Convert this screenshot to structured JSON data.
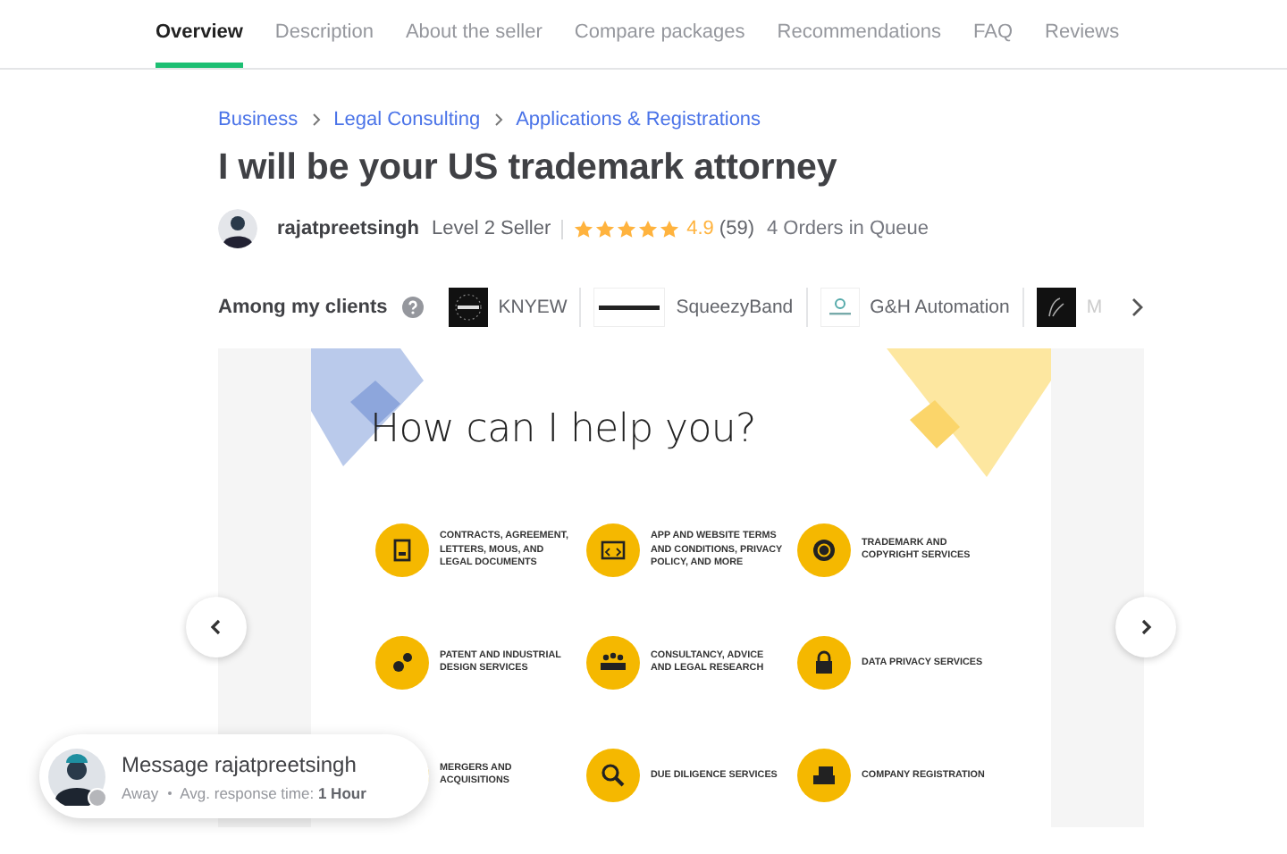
{
  "tabs": [
    {
      "label": "Overview",
      "selected": true
    },
    {
      "label": "Description",
      "selected": false
    },
    {
      "label": "About the seller",
      "selected": false
    },
    {
      "label": "Compare packages",
      "selected": false
    },
    {
      "label": "Recommendations",
      "selected": false
    },
    {
      "label": "FAQ",
      "selected": false
    },
    {
      "label": "Reviews",
      "selected": false
    }
  ],
  "breadcrumb": [
    "Business",
    "Legal Consulting",
    "Applications & Registrations"
  ],
  "title": "I will be your US trademark attorney",
  "seller": {
    "name": "rajatpreetsingh",
    "level": "Level 2 Seller",
    "stars": 5,
    "rating": "4.9",
    "reviews": "(59)",
    "queue": "4 Orders in Queue"
  },
  "clients": {
    "label": "Among my clients",
    "items": [
      {
        "name": "KNYEW"
      },
      {
        "name": "SqueezyBand"
      },
      {
        "name": "G&H Automation"
      },
      {
        "name": "M"
      }
    ]
  },
  "gallery": {
    "heading": "How can I help you?",
    "services": [
      "CONTRACTS, AGREEMENT, LETTERS, MOUS, AND LEGAL DOCUMENTS",
      "APP AND WEBSITE TERMS AND CONDITIONS, PRIVACY POLICY, AND MORE",
      "TRADEMARK AND COPYRIGHT SERVICES",
      "PATENT AND INDUSTRIAL DESIGN SERVICES",
      "CONSULTANCY, ADVICE AND LEGAL RESEARCH",
      "DATA PRIVACY SERVICES",
      "MERGERS AND ACQUISITIONS",
      "DUE DILIGENCE SERVICES",
      "COMPANY REGISTRATION"
    ]
  },
  "message": {
    "title": "Message rajatpreetsingh",
    "status": "Away",
    "response_label": "Avg. response time:",
    "response_value": "1 Hour"
  }
}
